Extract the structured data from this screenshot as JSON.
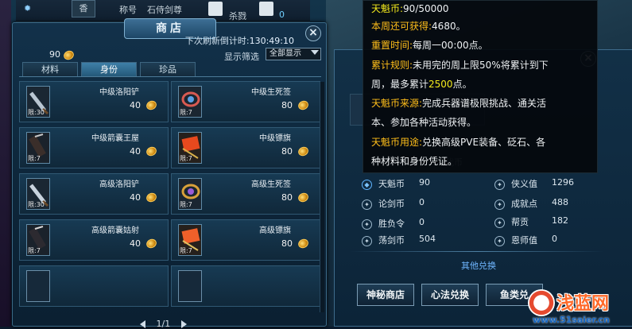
{
  "top_bar": {
    "title_label": "称号",
    "title_value": "石侍剑尊",
    "kill_label": "杀戮",
    "kill_value": "0",
    "tab_short": "香"
  },
  "shop": {
    "title": "商店",
    "refresh_label": "下次刷新倒计时:",
    "refresh_time": "130:49:10",
    "currency_amount": "90",
    "filter_label": "显示筛选",
    "filter_value": "全部显示",
    "tabs": [
      {
        "label": "材料",
        "active": false
      },
      {
        "label": "身份",
        "active": true
      },
      {
        "label": "珍品",
        "active": false
      }
    ],
    "items": [
      {
        "name": "中级洛阳铲",
        "price": "40",
        "limit": "限:30",
        "icon": "shovel-icon"
      },
      {
        "name": "中级生死签",
        "price": "80",
        "limit": "限:7",
        "icon": "charm-icon"
      },
      {
        "name": "中级箭囊王屋",
        "price": "40",
        "limit": "限:7",
        "icon": "quiver-icon"
      },
      {
        "name": "中级镖旗",
        "price": "80",
        "limit": "限:7",
        "icon": "banner-icon"
      },
      {
        "name": "高级洛阳铲",
        "price": "40",
        "limit": "限:30",
        "icon": "shovel-icon"
      },
      {
        "name": "高级生死签",
        "price": "80",
        "limit": "限:7",
        "icon": "charm-icon"
      },
      {
        "name": "高级箭囊姑射",
        "price": "40",
        "limit": "限:7",
        "icon": "quiver-icon"
      },
      {
        "name": "高级镖旗",
        "price": "80",
        "limit": "限:7",
        "icon": "banner-icon"
      }
    ],
    "pager": "1/1"
  },
  "tooltip": {
    "l1_label": "天魁币:",
    "l1_value": "90/50000",
    "l2_label": "本周还可获得:",
    "l2_value": "4680。",
    "l3_label": "重置时间:",
    "l3_value": "每周一00:00点。",
    "l4_label": "累计规则:",
    "l4_value": "未用完的周上限50%将累计到下",
    "l5_a": "周，最多累计",
    "l5_b": "2500",
    "l5_c": "点。",
    "l6_label": "天魁币来源:",
    "l6_value": "完成兵器谱极限挑战、通关活",
    "l7": "本、参加各种活动获得。",
    "l8_label": "天魁币用途:",
    "l8_value": "兑换高级PVE装备、砭石、各",
    "l9": "种材料和身份凭证。"
  },
  "right_panel": {
    "ghost_text": "代币",
    "stats_left": [
      {
        "label": "天魁币",
        "value": "90"
      },
      {
        "label": "论剑币",
        "value": "0"
      },
      {
        "label": "胜负令",
        "value": "0"
      },
      {
        "label": "荡剑币",
        "value": "504"
      }
    ],
    "stats_right": [
      {
        "label": "侠义值",
        "value": "1296"
      },
      {
        "label": "成就点",
        "value": "488"
      },
      {
        "label": "帮贡",
        "value": "182"
      },
      {
        "label": "恩师值",
        "value": "0"
      }
    ],
    "other_exchange": "其他兑换",
    "buttons": [
      "神秘商店",
      "心法兑换",
      "鱼类兑"
    ]
  },
  "watermark": {
    "text": "浅蓝网",
    "url": "www.51saier.cn"
  },
  "colors": {
    "tooltip_yellow": "#f4ea1c",
    "tooltip_orange": "#ffbe1a",
    "tab_active": "#3f7fa8"
  }
}
